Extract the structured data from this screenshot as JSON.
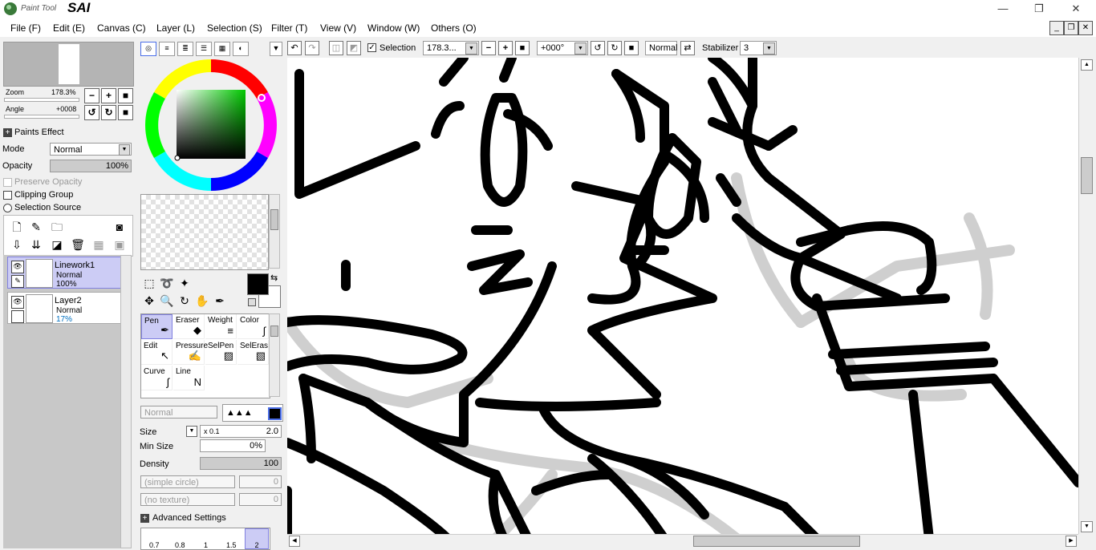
{
  "app": {
    "logo_top": "Paint Tool",
    "logo_main": "SAI"
  },
  "menu": [
    "File (F)",
    "Edit (E)",
    "Canvas (C)",
    "Layer (L)",
    "Selection (S)",
    "Filter (T)",
    "View (V)",
    "Window (W)",
    "Others (O)"
  ],
  "navigator": {
    "zoom_label": "Zoom",
    "zoom_value": "178.3%",
    "angle_label": "Angle",
    "angle_value": "+0008"
  },
  "layer_props": {
    "paints_effect": "Paints Effect",
    "mode_label": "Mode",
    "mode_value": "Normal",
    "opacity_label": "Opacity",
    "opacity_value": "100%",
    "preserve_opacity": "Preserve Opacity",
    "clipping_group": "Clipping Group",
    "selection_source": "Selection Source"
  },
  "layers": [
    {
      "name": "Linework1",
      "mode": "Normal",
      "opacity": "100%",
      "selected": true
    },
    {
      "name": "Layer2",
      "mode": "Normal",
      "opacity": "17%",
      "selected": false
    }
  ],
  "tools": [
    {
      "label": "Pen",
      "icon": "pen-icon"
    },
    {
      "label": "Eraser",
      "icon": "eraser-icon"
    },
    {
      "label": "Weight",
      "icon": "weight-icon"
    },
    {
      "label": "Color",
      "icon": "color-icon"
    },
    {
      "label": "Edit",
      "icon": "edit-icon"
    },
    {
      "label": "Pressure",
      "icon": "pressure-icon"
    },
    {
      "label": "SelPen",
      "icon": "selpen-icon"
    },
    {
      "label": "SelEras",
      "icon": "seleras-icon"
    },
    {
      "label": "Curve",
      "icon": "curve-icon"
    },
    {
      "label": "Line",
      "icon": "line-icon"
    }
  ],
  "brush": {
    "blend_mode": "Normal",
    "size_label": "Size",
    "size_mult": "x 0.1",
    "size_value": "2.0",
    "min_size_label": "Min Size",
    "min_size_value": "0%",
    "density_label": "Density",
    "density_value": "100",
    "shape": "(simple circle)",
    "shape_value": "0",
    "texture": "(no texture)",
    "texture_value": "0",
    "advanced": "Advanced Settings",
    "preset_sizes": [
      "0.7",
      "0.8",
      "1",
      "1.5",
      "2"
    ]
  },
  "toolbar": {
    "selection_label": "Selection",
    "zoom_value": "178.3...",
    "angle_value": "+000°",
    "blend_label": "Normal",
    "stabilizer_label": "Stabilizer",
    "stabilizer_value": "3"
  },
  "colors": {
    "foreground": "#000000",
    "background": "#ffffff",
    "selected_layer": "#ccccf5",
    "wheel_picked": "#00cc00"
  }
}
